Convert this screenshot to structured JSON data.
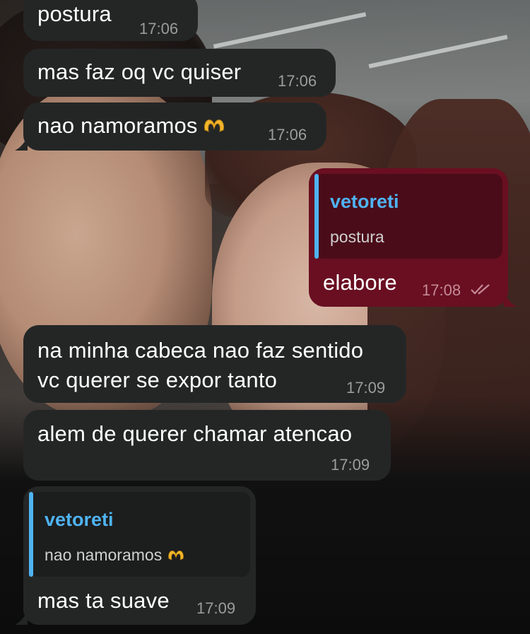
{
  "messages": [
    {
      "text": "postura",
      "time": "17:06",
      "direction": "in"
    },
    {
      "text": "mas faz oq vc quiser",
      "time": "17:06",
      "direction": "in"
    },
    {
      "text": "nao namoramos",
      "time": "17:06",
      "direction": "in",
      "icon": "hand-heart-icon"
    },
    {
      "text": "elabore",
      "time": "17:08",
      "direction": "out",
      "status_icon": "double-check-icon",
      "reply_to": {
        "name": "vetoreti",
        "text": "postura"
      }
    },
    {
      "line1": "na minha cabeca nao faz sentido",
      "line2": "vc querer se expor tanto",
      "time": "17:09",
      "direction": "in"
    },
    {
      "text": "alem de querer chamar atencao",
      "time": "17:09",
      "direction": "in"
    },
    {
      "text": "mas ta suave",
      "time": "17:09",
      "direction": "in",
      "reply_to": {
        "name": "vetoreti",
        "text": "nao namoramos",
        "icon": "hand-heart-icon"
      }
    }
  ],
  "colors": {
    "incoming_bubble": "#242626",
    "outgoing_bubble": "#6a0f22",
    "reply_name": "#4fb3f2",
    "timestamp": "#9b9c9c"
  }
}
